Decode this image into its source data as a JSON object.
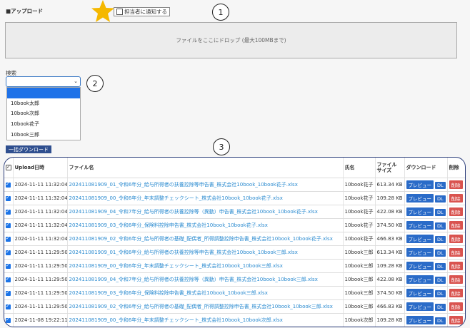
{
  "upload": {
    "title": "■アップロード",
    "notify_label": "担当者に通知する",
    "dropzone_text": "ファイルをここにドロップ (最大100MBまで)"
  },
  "annotations": [
    "1",
    "2",
    "3"
  ],
  "search": {
    "label": "検索",
    "selected": "",
    "options": [
      "",
      "10book太郎",
      "10book次郎",
      "10book花子",
      "10book三郎"
    ]
  },
  "bulk_download_label": "一括ダウンロード",
  "table": {
    "headers": {
      "check": "",
      "upload": "Upload日時",
      "filename": "ファイル名",
      "owner": "氏名",
      "size": "ファイル\nサイズ",
      "download": "ダウンロード",
      "delete": "削除"
    },
    "preview_label": "プレビュー",
    "dl_label": "DL",
    "delete_label": "削除",
    "rows": [
      {
        "date": "2024-11-11 11:32:04",
        "file": "202411081909_01_令和6年分_給与所得者の扶養控除等申告書_株式会社10book_10book花子.xlsx",
        "owner": "10book花子",
        "size": "613.34 KB"
      },
      {
        "date": "2024-11-11 11:32:04",
        "file": "202411081909_00_令和6年分_年末調整チェックシート_株式会社10book_10book花子.xlsx",
        "owner": "10book花子",
        "size": "109.28 KB"
      },
      {
        "date": "2024-11-11 11:32:04",
        "file": "202411081909_04_令和7年分_給与所得者の扶養控除等（異動）申告書_株式会社10book_10book花子.xlsx",
        "owner": "10book花子",
        "size": "422.08 KB"
      },
      {
        "date": "2024-11-11 11:32:04",
        "file": "202411081909_03_令和6年分_保険料控除申告書_株式会社10book_10book花子.xlsx",
        "owner": "10book花子",
        "size": "374.50 KB"
      },
      {
        "date": "2024-11-11 11:32:04",
        "file": "202411081909_02_令和6年分_給与所得者の基礎_配偶者_所得調整控除申告書_株式会社10book_10book花子.xlsx",
        "owner": "10book花子",
        "size": "466.83 KB"
      },
      {
        "date": "2024-11-11 11:29:50",
        "file": "202411081909_01_令和6年分_給与所得者の扶養控除等申告書_株式会社10book_10book三郎.xlsx",
        "owner": "10book三郎",
        "size": "613.34 KB"
      },
      {
        "date": "2024-11-11 11:29:50",
        "file": "202411081909_00_令和6年分_年末調整チェックシート_株式会社10book_10book三郎.xlsx",
        "owner": "10book三郎",
        "size": "109.28 KB"
      },
      {
        "date": "2024-11-11 11:29:50",
        "file": "202411081909_04_令和7年分_給与所得者の扶養控除等（異動）申告書_株式会社10book_10book三郎.xlsx",
        "owner": "10book三郎",
        "size": "422.08 KB"
      },
      {
        "date": "2024-11-11 11:29:50",
        "file": "202411081909_03_令和6年分_保険料控除申告書_株式会社10book_10book三郎.xlsx",
        "owner": "10book三郎",
        "size": "374.50 KB"
      },
      {
        "date": "2024-11-11 11:29:50",
        "file": "202411081909_02_令和6年分_給与所得者の基礎_配偶者_所得調整控除申告書_株式会社10book_10book三郎.xlsx",
        "owner": "10book三郎",
        "size": "466.83 KB"
      },
      {
        "date": "2024-11-08 19:22:11",
        "file": "202411081909_00_令和6年分_年末調整チェックシート_株式会社10book_10book次郎.xlsx",
        "owner": "10book次郎",
        "size": "109.28 KB"
      }
    ]
  },
  "colors": {
    "accent": "#2a6bc8",
    "link": "#2b8bd0",
    "delete": "#d9534f",
    "star": "#f5b800"
  }
}
